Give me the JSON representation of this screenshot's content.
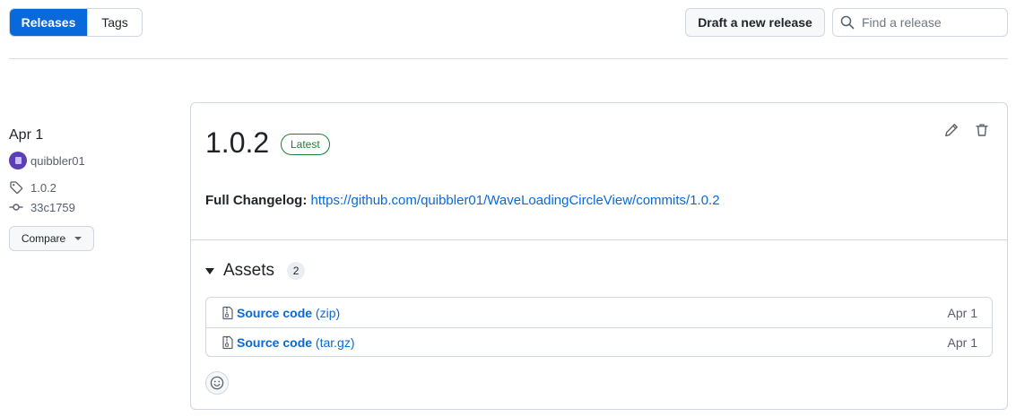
{
  "tabs": {
    "releases": "Releases",
    "tags": "Tags"
  },
  "header": {
    "draft_label": "Draft a new release",
    "search_placeholder": "Find a release",
    "search_value": ""
  },
  "sidebar": {
    "date": "Apr 1",
    "author": "quibbler01",
    "tag": "1.0.2",
    "commit": "33c1759",
    "compare_label": "Compare"
  },
  "release": {
    "version": "1.0.2",
    "badge": "Latest",
    "changelog_label": "Full Changelog:",
    "changelog_url": "https://github.com/quibbler01/WaveLoadingCircleView/commits/1.0.2"
  },
  "assets": {
    "title": "Assets",
    "count": "2",
    "items": [
      {
        "name": "Source code",
        "format": "(zip)",
        "date": "Apr 1"
      },
      {
        "name": "Source code",
        "format": "(tar.gz)",
        "date": "Apr 1"
      }
    ]
  },
  "colors": {
    "accent": "#0969da",
    "success": "#1a7f37",
    "border": "#d0d7de"
  },
  "icons": [
    "search-icon",
    "tag-icon",
    "commit-icon",
    "pencil-icon",
    "trash-icon",
    "file-zip-icon",
    "smiley-icon",
    "triangle-down-icon"
  ]
}
